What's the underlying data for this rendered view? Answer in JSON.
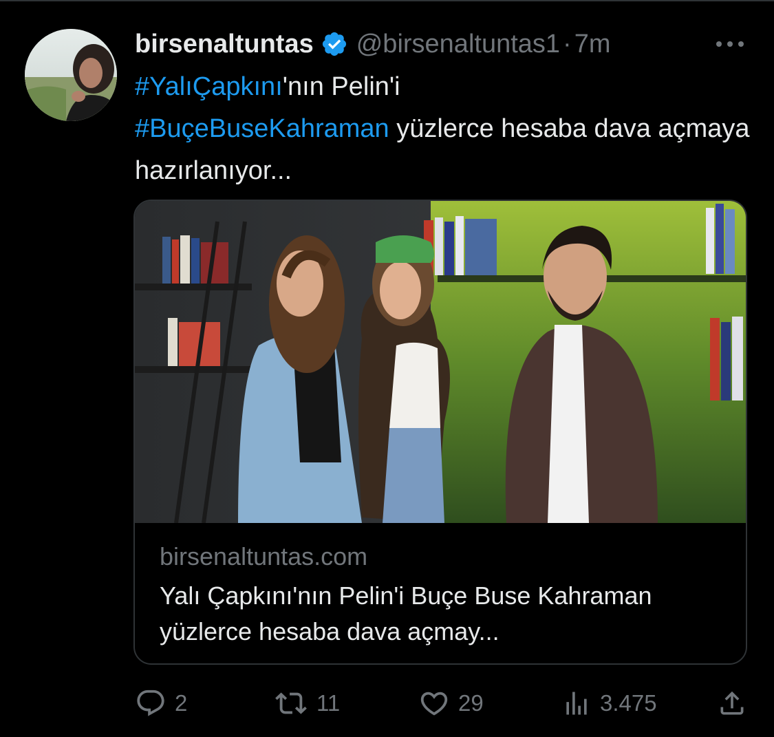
{
  "colors": {
    "background": "#000000",
    "text_primary": "#e7e9ea",
    "text_secondary": "#71767b",
    "link": "#1d9bf0",
    "verified": "#1d9bf0",
    "border": "#2f3336"
  },
  "tweet": {
    "display_name": "birsenaltuntas",
    "verified": true,
    "handle": "@birsenaltuntas1",
    "separator": "·",
    "time": "7m",
    "more_icon": "more-dots-icon",
    "text": {
      "hashtag1": "#YalıÇapkını",
      "text1": "'nın Pelin'i",
      "hashtag2": "#BuçeBuseKahraman",
      "text2": " yüzlerce hesaba dava açmaya hazırlanıyor..."
    }
  },
  "card": {
    "image_icon": "link-preview-photo",
    "domain": "birsenaltuntas.com",
    "title": "Yalı Çapkını'nın Pelin'i Buçe Buse Kahraman yüzlerce hesaba dava açmay..."
  },
  "actions": {
    "reply": {
      "icon": "reply-icon",
      "count": "2"
    },
    "retweet": {
      "icon": "retweet-icon",
      "count": "11"
    },
    "like": {
      "icon": "heart-icon",
      "count": "29"
    },
    "views": {
      "icon": "views-icon",
      "count": "3.475"
    },
    "share": {
      "icon": "share-icon"
    }
  }
}
